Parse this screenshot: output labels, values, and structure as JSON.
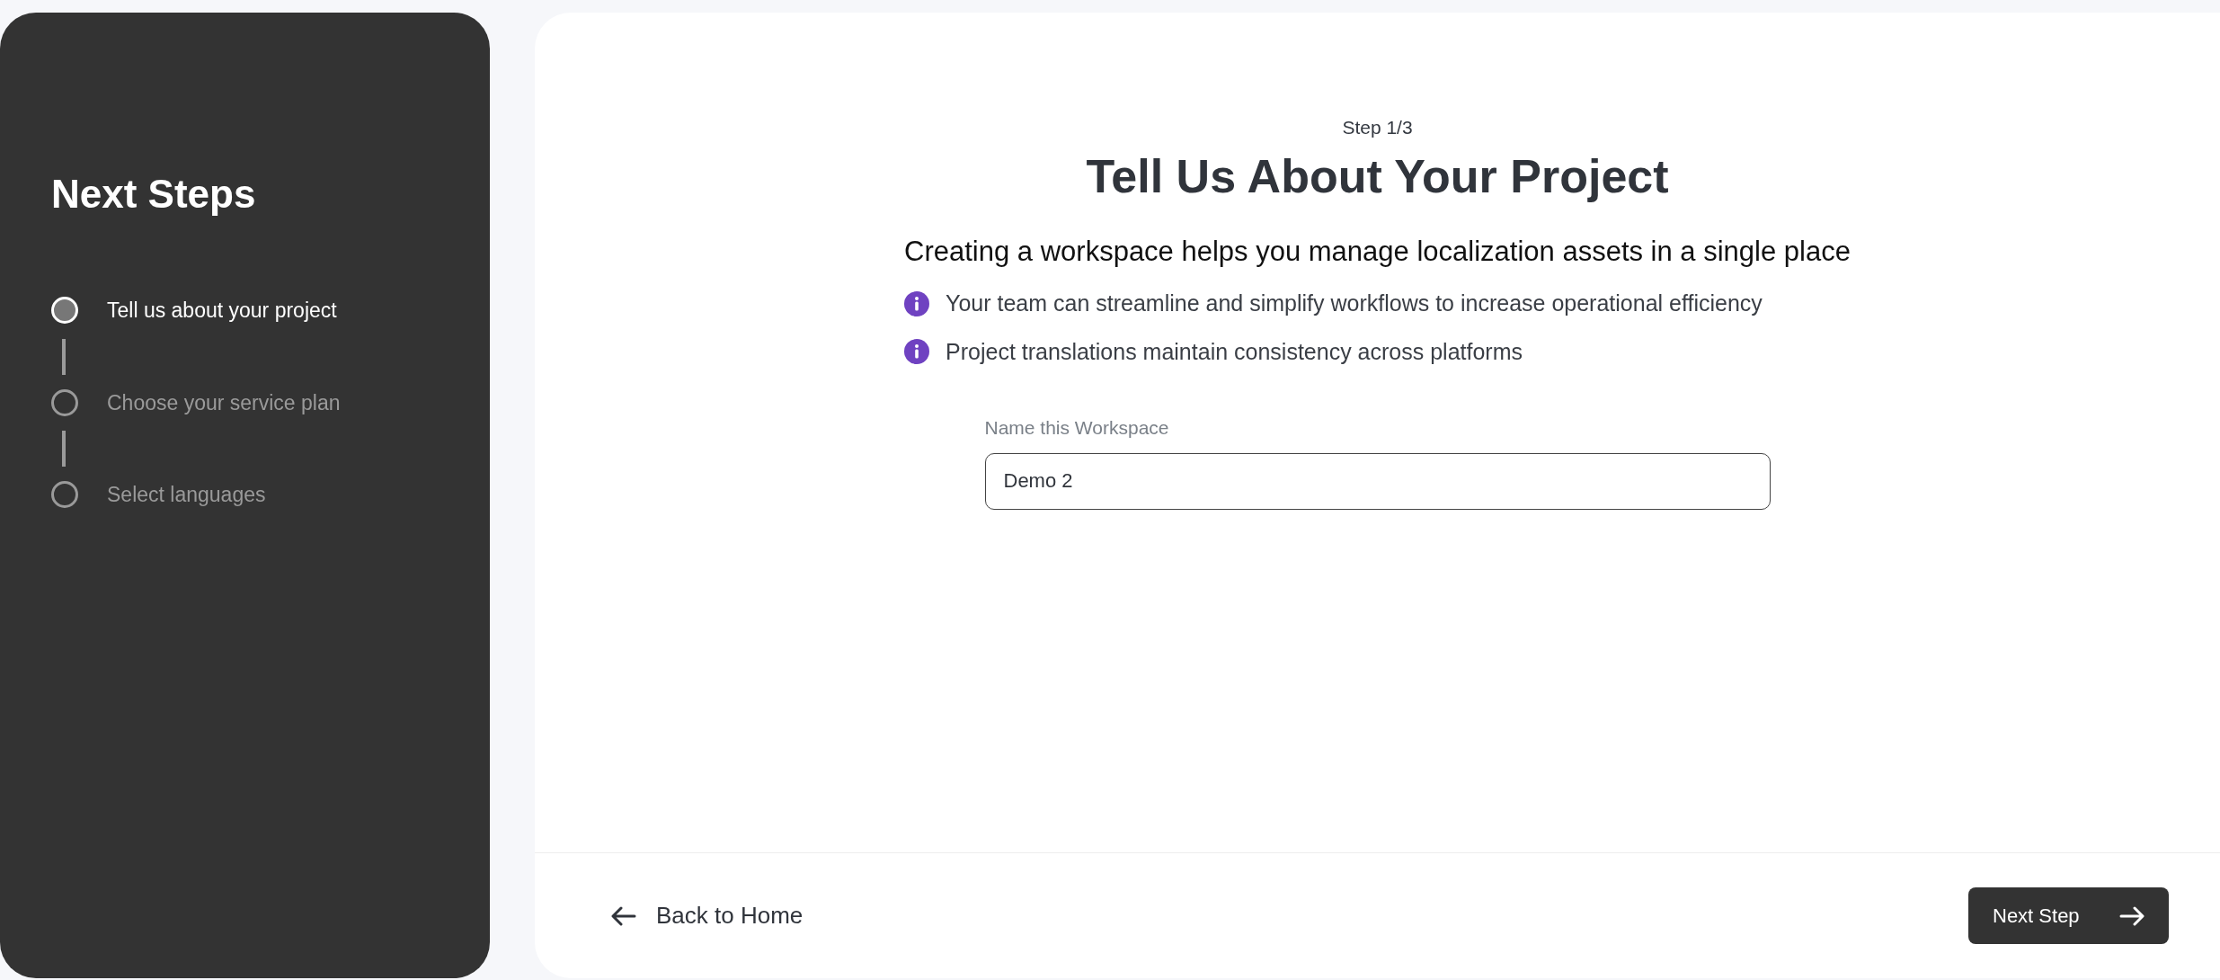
{
  "sidebar": {
    "title": "Next Steps",
    "steps": [
      {
        "label": "Tell us about your project",
        "selected": true
      },
      {
        "label": "Choose your service plan",
        "selected": false
      },
      {
        "label": "Select languages",
        "selected": false
      }
    ]
  },
  "main": {
    "step_indicator": "Step 1/3",
    "title": "Tell Us About Your Project",
    "subtitle": "Creating a workspace helps you manage localization assets in a single place",
    "bullets": [
      "Your team can streamline and simplify workflows to increase operational efficiency",
      "Project translations maintain consistency across platforms"
    ],
    "field": {
      "label": "Name this Workspace",
      "value": "Demo 2"
    }
  },
  "footer": {
    "back": "Back to Home",
    "next": "Next Step"
  }
}
